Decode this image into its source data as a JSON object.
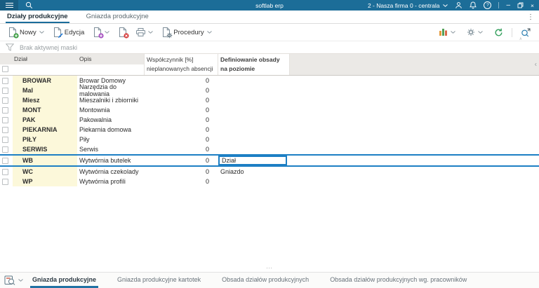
{
  "colors": {
    "titlebar": "#1c6d98",
    "tab_underline": "#1b6d9b",
    "accent": "#1d7fc4",
    "yellow": "#fcf8da"
  },
  "icons": {
    "overflow": "⋮",
    "chevron_left": "‹",
    "splitter_dots": "⋯",
    "collapse_caret": "∧"
  },
  "titlebar": {
    "app_title": "softlab erp",
    "company_selector": "2 - Nasza firma 0 - centrala"
  },
  "top_tabs": [
    {
      "label": "Działy produkcyjne",
      "active": true
    },
    {
      "label": "Gniazda produkcyjne",
      "active": false
    }
  ],
  "toolbar": {
    "new_label": "Nowy",
    "edit_label": "Edycja",
    "procedures_label": "Procedury"
  },
  "filter": {
    "text": "Brak aktywnej maski"
  },
  "grid": {
    "headers": {
      "dzial": "Dział",
      "opis": "Opis",
      "wspolczynnik_line1": "Współczynnik [%]",
      "wspolczynnik_line2": "nieplanowanych absencji",
      "definiowanie_line1": "Definiowanie obsady",
      "definiowanie_line2": "na poziomie"
    },
    "rows": [
      {
        "dzial": "BROWAR",
        "opis": "Browar Domowy",
        "wspolczynnik": "0",
        "definiowanie": ""
      },
      {
        "dzial": "Mal",
        "opis": "Narzędzia do malowania",
        "wspolczynnik": "0",
        "definiowanie": ""
      },
      {
        "dzial": "Miesz",
        "opis": "Mieszalniki i zbiorniki",
        "wspolczynnik": "0",
        "definiowanie": ""
      },
      {
        "dzial": "MONT",
        "opis": "Montownia",
        "wspolczynnik": "0",
        "definiowanie": ""
      },
      {
        "dzial": "PAK",
        "opis": "Pakowalnia",
        "wspolczynnik": "0",
        "definiowanie": ""
      },
      {
        "dzial": "PIEKARNIA",
        "opis": "Piekarnia domowa",
        "wspolczynnik": "0",
        "definiowanie": ""
      },
      {
        "dzial": "PIŁY",
        "opis": "Piły",
        "wspolczynnik": "0",
        "definiowanie": ""
      },
      {
        "dzial": "SERWIS",
        "opis": "Serwis",
        "wspolczynnik": "0",
        "definiowanie": ""
      },
      {
        "dzial": "WB",
        "opis": "Wytwórnia butelek",
        "wspolczynnik": "0",
        "definiowanie": "Dział",
        "selected": true,
        "editing": true
      },
      {
        "dzial": "WC",
        "opis": "Wytwórnia czekolady",
        "wspolczynnik": "0",
        "definiowanie": "Gniazdo"
      },
      {
        "dzial": "WP",
        "opis": "Wytwórnia profili",
        "wspolczynnik": "0",
        "definiowanie": ""
      }
    ]
  },
  "bottom_tabs": [
    {
      "label": "Gniazda produkcyjne",
      "active": true
    },
    {
      "label": "Gniazda produkcyjne kartotek",
      "active": false
    },
    {
      "label": "Obsada działów produkcyjnych",
      "active": false
    },
    {
      "label": "Obsada działów produkcyjnych wg. pracowników",
      "active": false
    }
  ]
}
